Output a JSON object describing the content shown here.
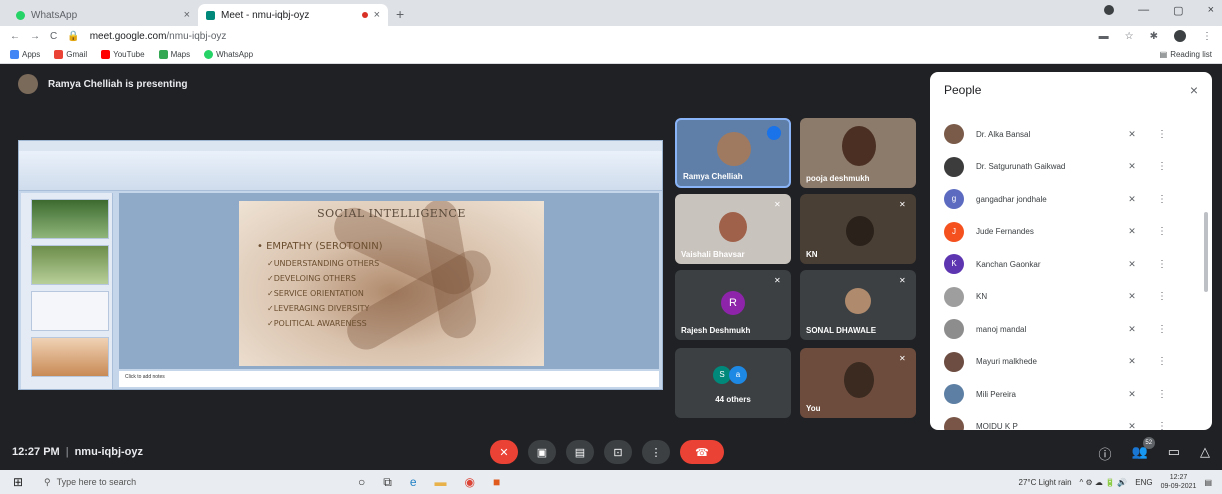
{
  "browser": {
    "tabs": [
      {
        "title": "WhatsApp",
        "close": "×"
      },
      {
        "title": "Meet - nmu-iqbj-oyz",
        "close": "×"
      }
    ],
    "new_tab": "+",
    "url_host": "meet.google.com",
    "url_path": "/nmu-iqbj-oyz",
    "window_controls": [
      "—",
      "▢",
      "×"
    ],
    "bookmarks": [
      {
        "label": "Apps",
        "color": "#4285f4"
      },
      {
        "label": "Gmail",
        "color": "#ea4335"
      },
      {
        "label": "YouTube",
        "color": "#ff0000"
      },
      {
        "label": "Maps",
        "color": "#34a853"
      },
      {
        "label": "WhatsApp",
        "color": "#25d366"
      }
    ],
    "reading_list": "Reading list"
  },
  "meet": {
    "presenting_banner": "Ramya Chelliah is presenting",
    "presentation": {
      "notes": "Click to add notes",
      "slide": {
        "title": "SOCIAL INTELLIGENCE",
        "main_point": "• EMPATHY (SEROTONIN)",
        "sub_points": [
          "✓UNDERSTANDING OTHERS",
          "✓DEVELOING OTHERS",
          "✓SERVICE ORIENTATION",
          "✓LEVERAGING DIVERSITY",
          "✓POLITICAL AWARENESS"
        ]
      }
    },
    "tiles": [
      {
        "name": "Ramya Chelliah",
        "bg": "#5f7fa8"
      },
      {
        "name": "pooja deshmukh",
        "bg": "#8c7a6a"
      },
      {
        "name": "Vaishali Bhavsar",
        "bg": "#c9c3bd"
      },
      {
        "name": "KN",
        "bg": "#4a3f35"
      },
      {
        "name": "Rajesh Deshmukh",
        "letter": "R",
        "letter_color": "#8e24aa"
      },
      {
        "name": "SONAL DHAWALE",
        "bg": "#3c4043"
      },
      {
        "name": "44 others",
        "letters": [
          "S",
          "a"
        ]
      },
      {
        "name": "You",
        "bg": "#6d4c3d"
      }
    ],
    "meeting_time": "12:27 PM",
    "meeting_code": "nmu-iqbj-oyz",
    "participant_count": "52",
    "controls": {
      "mic": "mic-off",
      "camera": "camera",
      "captions": "captions",
      "present": "present",
      "more": "⋮",
      "hangup": "hang up"
    },
    "side_controls": [
      "ⓘ",
      "people",
      "chat",
      "activities"
    ]
  },
  "people_panel": {
    "title": "People",
    "close": "×",
    "participants": [
      {
        "name": "Dr. Alka Bansal",
        "avatar_color": "#7a5a48",
        "letter": ""
      },
      {
        "name": "Dr. Satgurunath Gaikwad",
        "avatar_color": "#3c3c3c",
        "letter": ""
      },
      {
        "name": "gangadhar jondhale",
        "avatar_color": "#5c6bc0",
        "letter": "g"
      },
      {
        "name": "Jude Fernandes",
        "avatar_color": "#f4511e",
        "letter": "J"
      },
      {
        "name": "Kanchan Gaonkar",
        "avatar_color": "#5e35b1",
        "letter": "K"
      },
      {
        "name": "KN",
        "avatar_color": "#9e9e9e",
        "letter": ""
      },
      {
        "name": "manoj mandal",
        "avatar_color": "#8d8d8d",
        "letter": ""
      },
      {
        "name": "Mayuri malkhede",
        "avatar_color": "#6d4c41",
        "letter": ""
      },
      {
        "name": "Mili Pereira",
        "avatar_color": "#5d7fa3",
        "letter": ""
      },
      {
        "name": "MOIDU K P",
        "avatar_color": "#795548",
        "letter": ""
      }
    ],
    "mic_icon": "🎤",
    "more_icon": "⋮"
  },
  "taskbar": {
    "search_placeholder": "Type here to search",
    "weather": "27°C Light rain",
    "lang": "ENG",
    "time": "12:27",
    "date": "09-09-2021"
  }
}
